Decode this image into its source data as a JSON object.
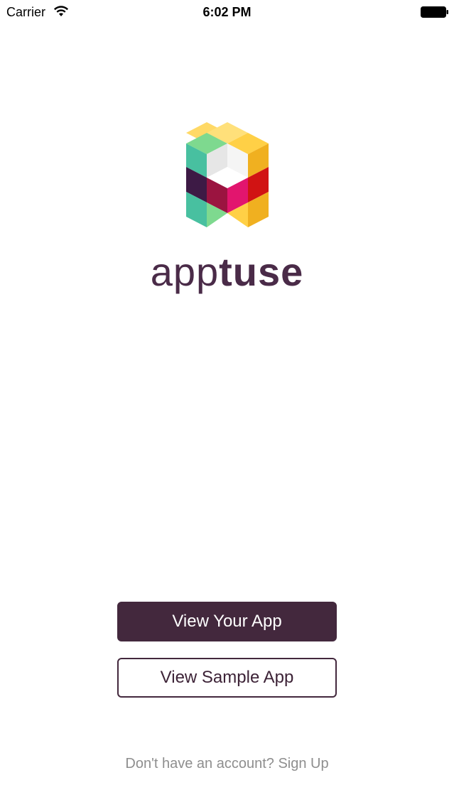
{
  "status_bar": {
    "carrier": "Carrier",
    "time": "6:02 PM",
    "wifi_icon": "wifi-icon",
    "battery_icon": "battery-icon"
  },
  "brand": {
    "logo_icon": "apptuse-cube-logo",
    "name_part1": "app",
    "name_part2": "tuse",
    "color": "#4a2b48"
  },
  "actions": {
    "view_your_app": "View Your App",
    "view_sample_app": "View Sample App",
    "primary_color": "#43283d"
  },
  "footer": {
    "prompt": "Don't have an account?",
    "signup_link": "Sign Up"
  }
}
